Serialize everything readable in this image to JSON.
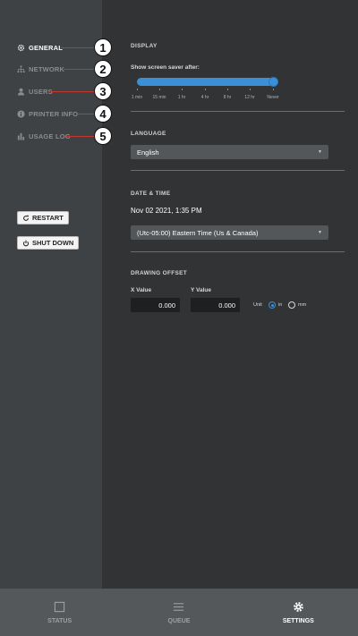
{
  "sidebar": {
    "items": [
      {
        "label": "GENERAL",
        "icon": "gear-icon",
        "active": true
      },
      {
        "label": "NETWORK",
        "icon": "network-icon",
        "active": false
      },
      {
        "label": "USERS",
        "icon": "user-icon",
        "active": false
      },
      {
        "label": "PRINTER INFO",
        "icon": "info-icon",
        "active": false
      },
      {
        "label": "USAGE LOG",
        "icon": "bar-chart-icon",
        "active": false
      }
    ],
    "callouts": [
      "1",
      "2",
      "3",
      "4",
      "5"
    ],
    "restart_label": "RESTART",
    "shutdown_label": "SHUT DOWN"
  },
  "display": {
    "section_title": "DISPLAY",
    "screensaver_label": "Show screen saver after:",
    "slider_ticks": [
      "1 min",
      "15 min",
      "1 hr",
      "4 hr",
      "8 hr",
      "12 hr",
      "Never"
    ],
    "slider_selected": "Never"
  },
  "language": {
    "section_title": "LANGUAGE",
    "value": "English"
  },
  "datetime": {
    "section_title": "DATE & TIME",
    "current": "Nov 02 2021, 1:35 PM",
    "timezone": "(Utc-05:00) Eastern Time (Us & Canada)"
  },
  "drawing_offset": {
    "section_title": "DRAWING OFFSET",
    "x_label": "X Value",
    "y_label": "Y Value",
    "x_value": "0.000",
    "y_value": "0.000",
    "unit_label": "Unit",
    "unit_options": [
      "in",
      "mm"
    ],
    "unit_selected": "in"
  },
  "bottom_nav": [
    {
      "label": "STATUS",
      "icon": "status-square-icon",
      "active": false
    },
    {
      "label": "QUEUE",
      "icon": "queue-list-icon",
      "active": false
    },
    {
      "label": "SETTINGS",
      "icon": "gear-icon",
      "active": true
    }
  ],
  "colors": {
    "accent": "#3a8fd6",
    "callout_line": "#c0392b",
    "background": "#313335",
    "sidebar": "#3f4245",
    "nav_bar": "#54585b"
  }
}
